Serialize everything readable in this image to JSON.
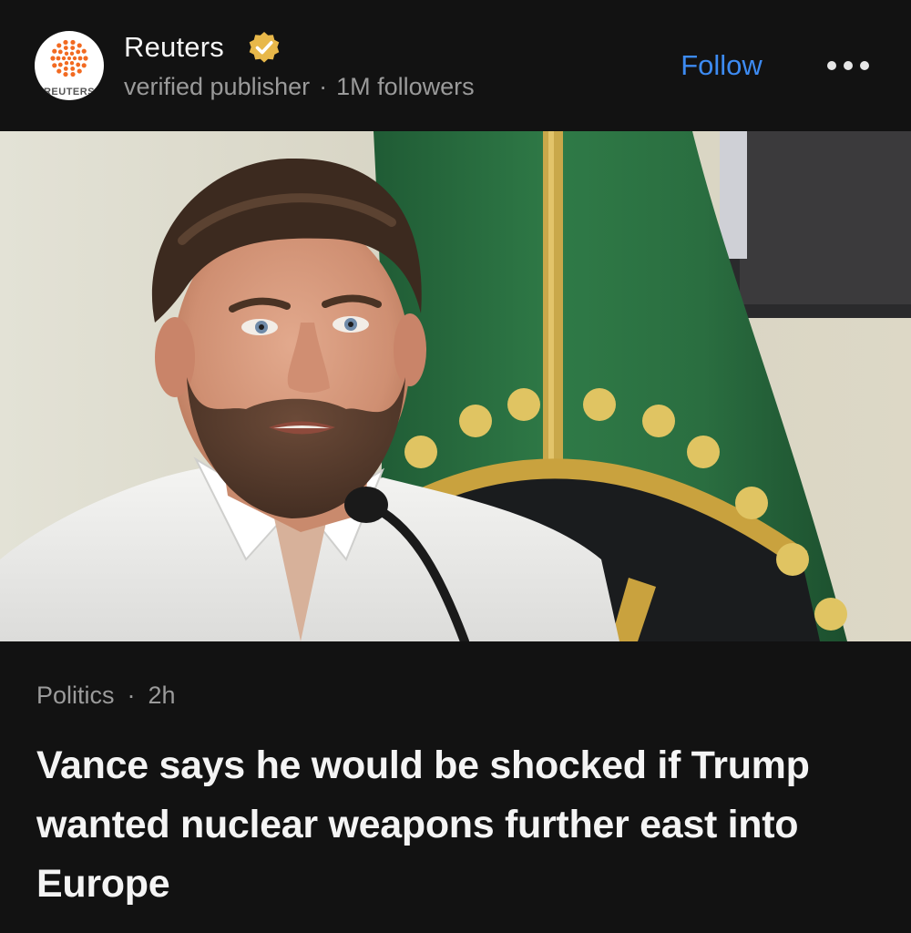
{
  "publisher": {
    "logo_text": "REUTERS",
    "name": "Reuters",
    "descriptor": "verified publisher",
    "separator": "·",
    "followers": "1M followers",
    "follow_label": "Follow",
    "verified_icon": "verified-check-icon",
    "more_icon": "more-dots-icon"
  },
  "article": {
    "category": "Politics",
    "separator": "·",
    "age": "2h",
    "headline": "Vance says he would be shocked if Trump wanted nuclear weapons further east into Europe"
  },
  "colors": {
    "background": "#121212",
    "accent": "#3d8bf2",
    "secondary_text": "#9b9b9b",
    "badge": "#e8b84a",
    "reuters_orange": "#f26a21"
  }
}
